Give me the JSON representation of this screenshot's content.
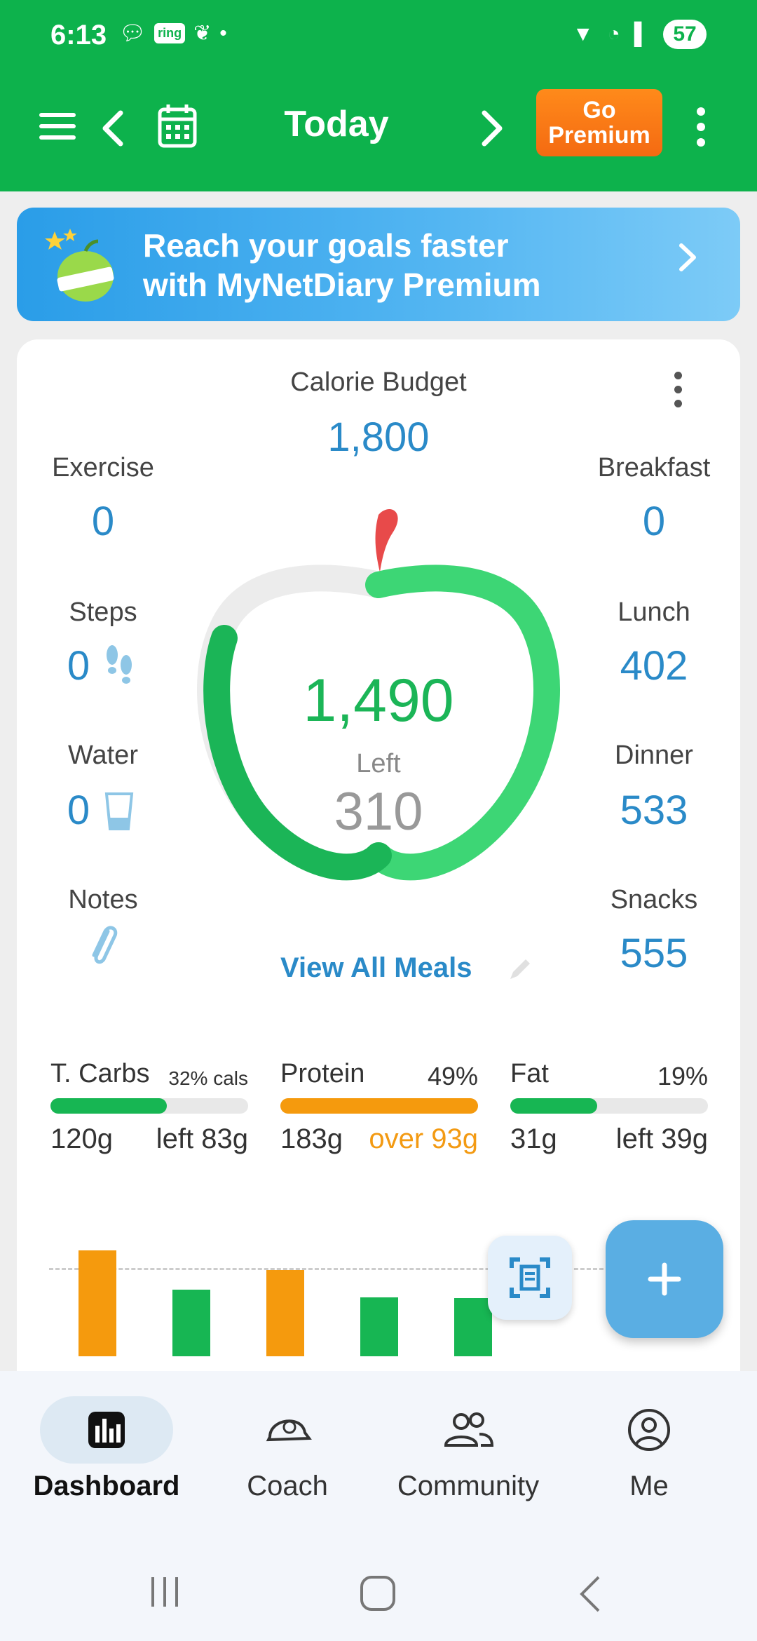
{
  "status_bar": {
    "time": "6:13",
    "ring_badge": "ring",
    "battery": "57"
  },
  "app_bar": {
    "title": "Today",
    "premium_label_1": "Go",
    "premium_label_2": "Premium"
  },
  "banner": {
    "line1": "Reach your goals faster",
    "line2": "with MyNetDiary Premium"
  },
  "dashboard": {
    "calorie_budget_label": "Calorie Budget",
    "calorie_budget_value": "1,800",
    "exercise_label": "Exercise",
    "exercise_value": "0",
    "steps_label": "Steps",
    "steps_value": "0",
    "water_label": "Water",
    "water_value": "0",
    "notes_label": "Notes",
    "breakfast_label": "Breakfast",
    "breakfast_value": "0",
    "lunch_label": "Lunch",
    "lunch_value": "402",
    "dinner_label": "Dinner",
    "dinner_value": "533",
    "snacks_label": "Snacks",
    "snacks_value": "555",
    "consumed_value": "1,490",
    "left_label": "Left",
    "left_value": "310",
    "consumed_fraction": 0.83,
    "view_all_meals": "View All Meals"
  },
  "macros": [
    {
      "name": "T. Carbs",
      "pct": "32% cals",
      "grams": "120g",
      "remaining": "left 83g",
      "fill": 0.59,
      "color": "#17b653",
      "over": false
    },
    {
      "name": "Protein",
      "pct": "49%",
      "grams": "183g",
      "remaining": "over 93g",
      "fill": 1.0,
      "color": "#f59a0d",
      "over": true
    },
    {
      "name": "Fat",
      "pct": "19%",
      "grams": "31g",
      "remaining": "left 39g",
      "fill": 0.44,
      "color": "#17b653",
      "over": false
    }
  ],
  "week_chart": {
    "bars": [
      {
        "level": 1.08,
        "color": "#f59a0d"
      },
      {
        "level": 0.68,
        "color": "#17b653"
      },
      {
        "level": 0.88,
        "color": "#f59a0d"
      },
      {
        "level": 0.6,
        "color": "#17b653"
      },
      {
        "level": 0.59,
        "color": "#17b653"
      }
    ]
  },
  "bottom_nav": [
    {
      "label": "Dashboard",
      "active": true
    },
    {
      "label": "Coach",
      "active": false
    },
    {
      "label": "Community",
      "active": false
    },
    {
      "label": "Me",
      "active": false
    }
  ]
}
